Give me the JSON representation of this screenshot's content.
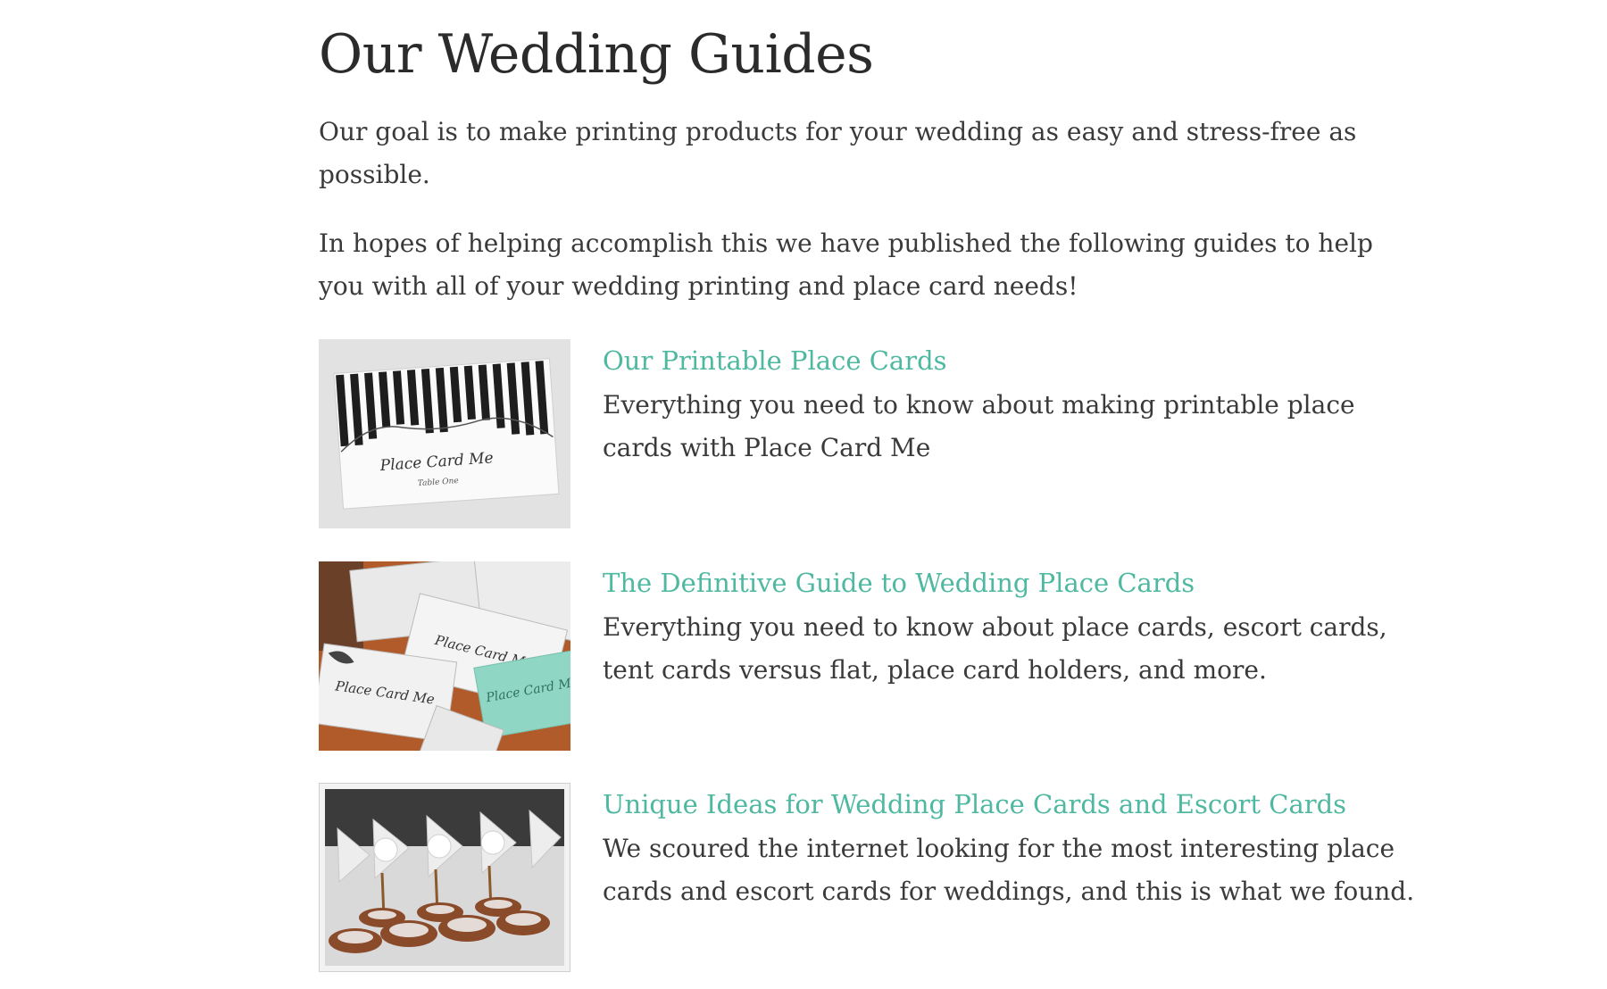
{
  "page": {
    "title": "Our Wedding Guides",
    "intro_1": "Our goal is to make printing products for your wedding as easy and stress-free as possible.",
    "intro_2": "In hopes of helping accomplish this we have published the following guides to help you with all of your wedding printing and place card needs!"
  },
  "guides": [
    {
      "title": "Our Printable Place Cards",
      "description": "Everything you need to know about making printable place cards with Place Card Me",
      "thumb_caption": "Place Card Me",
      "thumb_subcaption": "Table One"
    },
    {
      "title": "The Definitive Guide to Wedding Place Cards",
      "description": "Everything you need to know about place cards, escort cards, tent cards versus flat, place card holders, and more.",
      "thumb_caption": "Place Card Me"
    },
    {
      "title": "Unique Ideas for Wedding Place Cards and Escort Cards",
      "description": "We scoured the internet looking for the most interesting place cards and escort cards for weddings, and this is what we found."
    }
  ],
  "colors": {
    "link": "#4fb8a0",
    "text": "#3a3a3a",
    "heading": "#2b2b2b"
  }
}
